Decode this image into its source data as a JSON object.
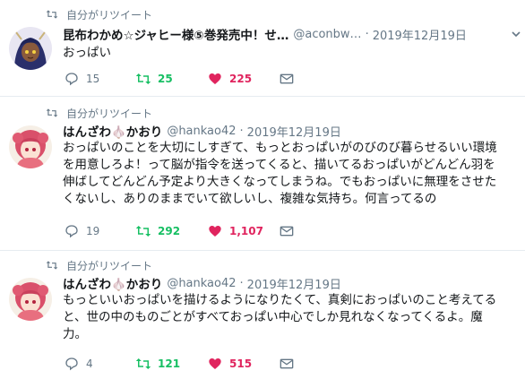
{
  "colors": {
    "retweet_green": "#17bf63",
    "like_red": "#e0245e",
    "meta_gray": "#657786",
    "text": "#14171a"
  },
  "tweets": [
    {
      "retweet_label": "自分がリツイート",
      "name": "昆布わかめ☆ジャヒー様⑤巻発売中！せ…",
      "handle": "@aconbw…",
      "dot": "·",
      "date": "2019年12月19日",
      "lines": [
        "おっぱい"
      ],
      "reply_count": "15",
      "retweet_count": "25",
      "like_count": "225"
    },
    {
      "retweet_label": "自分がリツイート",
      "name": "はんざわ🧄かおり",
      "handle": "@hankao42",
      "dot": "·",
      "date": "2019年12月19日",
      "lines": [
        "おっぱいのことを大切にしすぎて、もっとおっぱいがのびのび暮らせるいい環境",
        "を用意しろよ！って脳が指令を送ってくると、描いてるおっぱいがどんどん羽を",
        "伸ばしてどんどん予定より大きくなってしまうね。でもおっぱいに無理をさせた",
        "くないし、ありのままでいて欲しいし、複雑な気持ち。何言ってるの"
      ],
      "reply_count": "19",
      "retweet_count": "292",
      "like_count": "1,107"
    },
    {
      "retweet_label": "自分がリツイート",
      "name": "はんざわ🧄かおり",
      "handle": "@hankao42",
      "dot": "·",
      "date": "2019年12月19日",
      "lines": [
        "もっといいおっぱいを描けるようになりたくて、真剣におっぱいのこと考えてる",
        "と、世の中のものごとがすべておっぱい中心でしか見れなくなってくるよ。魔",
        "力。"
      ],
      "reply_count": "4",
      "retweet_count": "121",
      "like_count": "515"
    }
  ]
}
